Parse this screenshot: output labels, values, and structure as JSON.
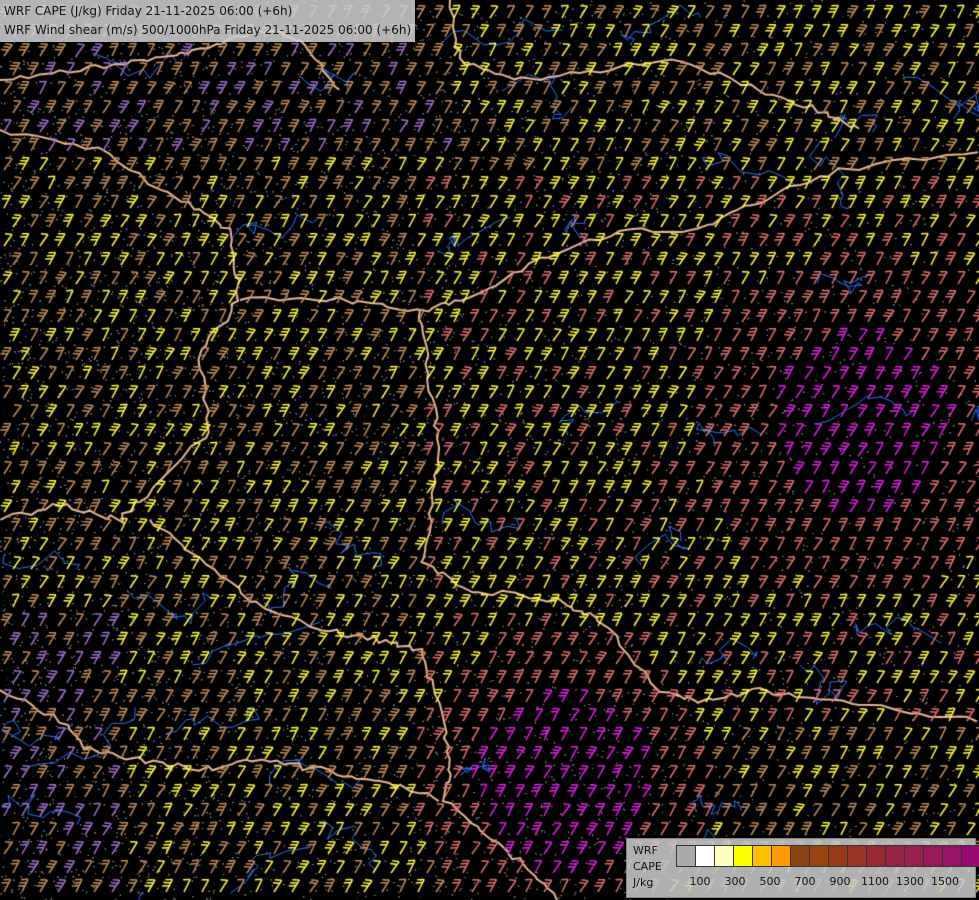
{
  "title": {
    "line1": "WRF CAPE (J/kg) Friday 21-11-2025 06:00 (+6h)",
    "line2": "WRF Wind shear (m/s) 500/1000hPa Friday 21-11-2025 06:00 (+6h)"
  },
  "legend": {
    "label_model": "WRF",
    "label_var": "CAPE",
    "label_unit": "J/kg",
    "colors": [
      "#a9a9a9",
      "#ffffff",
      "#ffffc0",
      "#ffff00",
      "#ffc000",
      "#ff9900",
      "#8b4513",
      "#994411",
      "#9b3a18",
      "#993322",
      "#992830",
      "#992244",
      "#99204d",
      "#991a5a",
      "#991266",
      "#990b70",
      "#990077",
      "#8b0080"
    ],
    "tick_labels": [
      "100",
      "300",
      "500",
      "700",
      "900",
      "1100",
      "1300",
      "1500"
    ]
  },
  "barb_colors": {
    "calm": "#c48e5a",
    "low": "#ffff33",
    "mid": "#e47070",
    "high": "#e020e0",
    "faint": "#a070d0"
  },
  "boundary_color": "#e8b890",
  "river_color": "#3070ff"
}
